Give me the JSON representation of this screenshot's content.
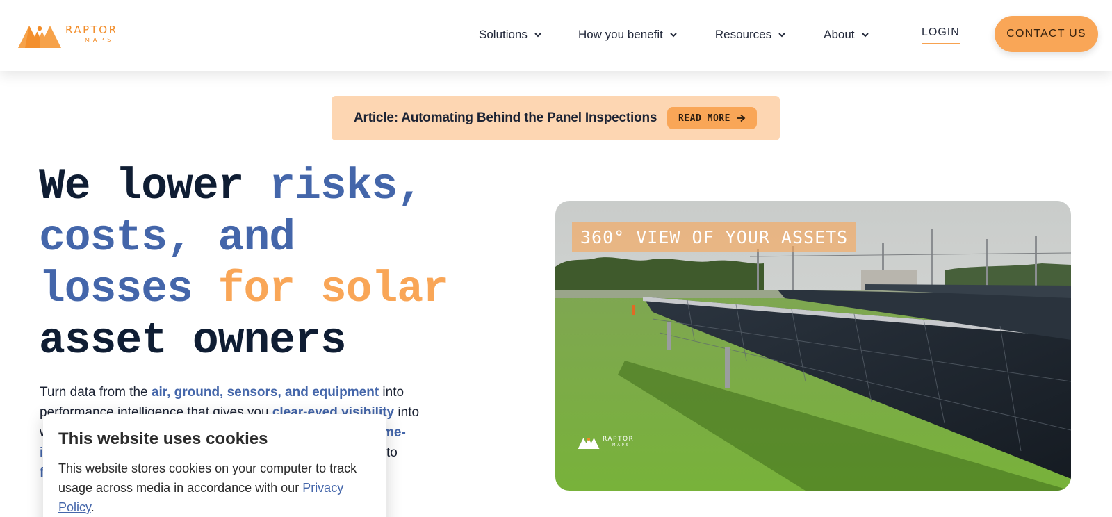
{
  "logo": {
    "name_top": "RAPTOR",
    "name_bottom": "MAPS",
    "color": "#f28c28"
  },
  "nav": {
    "items": [
      {
        "label": "Solutions",
        "icon": "chevron-down-icon"
      },
      {
        "label": "How you benefit",
        "icon": "chevron-down-icon"
      },
      {
        "label": "Resources",
        "icon": "chevron-down-icon"
      },
      {
        "label": "About",
        "icon": "chevron-down-icon"
      }
    ],
    "login_label": "LOGIN",
    "contact_label": "CONTACT US"
  },
  "banner": {
    "text": "Article: Automating Behind the Panel Inspections",
    "button_label": "READ MORE",
    "button_icon": "arrow-right-icon"
  },
  "hero": {
    "title_parts": {
      "p1": "We lower ",
      "p2": "risks,",
      "p3": "costs, and",
      "p4": "losses ",
      "p5": "for solar",
      "p6": "asset owners"
    },
    "desc_parts": {
      "d1": "Turn data from the ",
      "d2": "air, ground, sensors, and equipment",
      "d3": " into performance intelligence that gives you ",
      "d4": "clear-eyed visibility",
      "d5": " into",
      "d6": "w",
      "d7": "ime-",
      "d8": "i",
      "d9": "me to",
      "d10": "f"
    },
    "colors": {
      "accent_blue": "#4466aa",
      "accent_orange": "#f9a657",
      "dark": "#0f1d33"
    }
  },
  "video": {
    "label": "360° VIEW OF YOUR ASSETS",
    "watermark_top": "RAPTOR",
    "watermark_bottom": "MAPS"
  },
  "cookie": {
    "title": "This website uses cookies",
    "text_before": "This website stores cookies on your computer to track usage across media in accordance with our ",
    "link": "Privacy Policy",
    "text_after": "."
  }
}
